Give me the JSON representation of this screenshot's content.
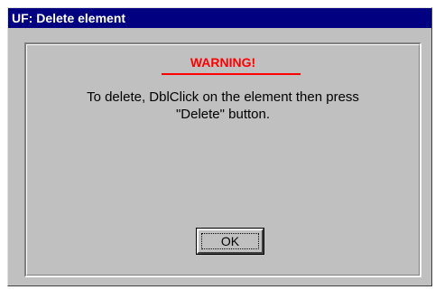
{
  "window": {
    "title": "UF: Delete element"
  },
  "dialog": {
    "warning_label": "WARNING!",
    "message_line1": "To delete, DblClick on the element then press",
    "message_line2": "\"Delete\" button.",
    "ok_label": "OK"
  },
  "colors": {
    "titlebar": "#000080",
    "warning": "#ff0000",
    "face": "#c0c0c0"
  }
}
